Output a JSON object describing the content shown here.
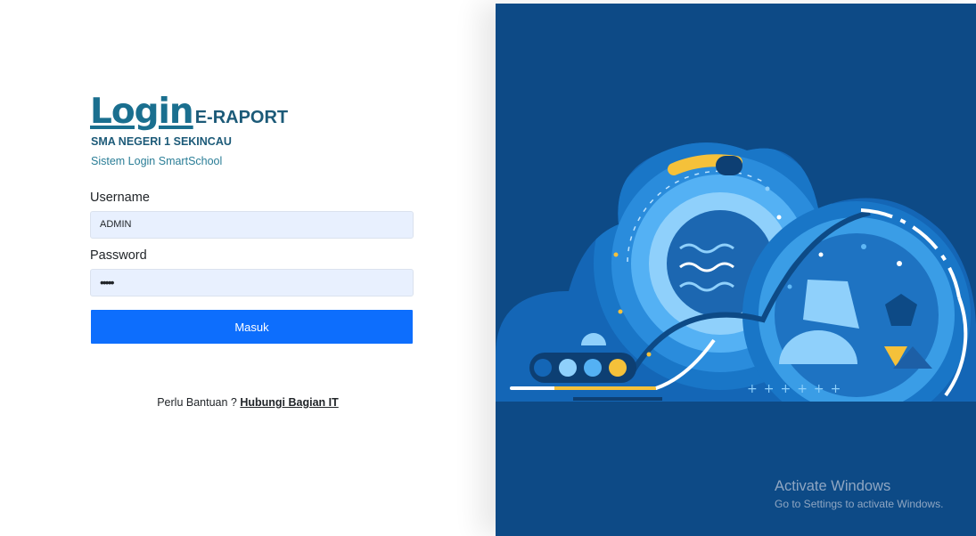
{
  "brand": {
    "login_word": "Login",
    "app_name": "E-RAPORT",
    "school": "SMA NEGERI 1 SEKINCAU",
    "subtitle": "Sistem Login SmartSchool"
  },
  "form": {
    "username_label": "Username",
    "username_value": "ADMIN",
    "password_label": "Password",
    "password_value": "•••••",
    "submit_label": "Masuk"
  },
  "help": {
    "text": "Perlu Bantuan ? ",
    "link": "Hubungi Bagian IT"
  },
  "watermark": {
    "title": "Activate Windows",
    "subtitle": "Go to Settings to activate Windows."
  },
  "colors": {
    "primary_button": "#0d6efd",
    "brand_teal": "#1a6f8f",
    "panel_background": "#0d4a86",
    "input_background": "#e8f0fe",
    "illustration_yellow": "#f5c13a"
  }
}
